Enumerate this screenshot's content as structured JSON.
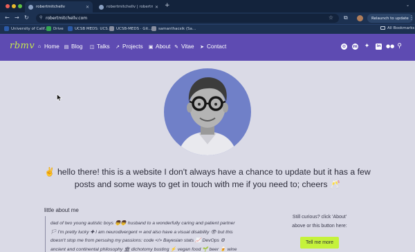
{
  "browser": {
    "tabs": [
      {
        "label": "robertmitchellv",
        "active": true
      },
      {
        "label": "robertmitchellv | robertmitchellv",
        "active": false
      }
    ],
    "new_tab_icon": "plus-icon",
    "url": "robertmitchellv.com",
    "relaunch_label": "Relaunch to update",
    "bookmarks": [
      {
        "label": "University of Calif...",
        "color": "#2b5aa8"
      },
      {
        "label": "Drive",
        "color": "#34a853"
      },
      {
        "label": "UCSB MEDS: UCS...",
        "color": "#2b5aa8"
      },
      {
        "label": "UCSB-MEDS · Git...",
        "color": "#8a8fa0"
      },
      {
        "label": "samanthacsik (Sa...",
        "color": "#8a8fa0"
      }
    ],
    "all_bookmarks": "All Bookmarks"
  },
  "site": {
    "logo": "rbmv",
    "nav": [
      {
        "label": "Home",
        "icon": "home-icon",
        "glyph": "⌂"
      },
      {
        "label": "Blog",
        "icon": "blog-icon",
        "glyph": "▤"
      },
      {
        "label": "Talks",
        "icon": "talks-icon",
        "glyph": "◫"
      },
      {
        "label": "Projects",
        "icon": "projects-icon",
        "glyph": "↗"
      },
      {
        "label": "About",
        "icon": "about-icon",
        "glyph": "▣"
      },
      {
        "label": "Vitae",
        "icon": "vitae-icon",
        "glyph": "✎"
      },
      {
        "label": "Contact",
        "icon": "contact-icon",
        "glyph": "➤"
      }
    ],
    "social_icons": [
      "github-icon",
      "mastodon-icon",
      "twitter-icon",
      "linkedin-icon",
      "flickr-icon",
      "search-icon"
    ],
    "colors": {
      "header": "#5e4bb2",
      "logo": "#c5e84f",
      "page_bg": "#dadae6",
      "button": "#c5f23b",
      "portrait_bg": "#7080c8"
    }
  },
  "main": {
    "greeting": "✌ hello there! this is a website I don't always have a chance to update but it has a few posts and some ways to get in touch with me if you need to; cheers 🥂",
    "about_title": "little about me",
    "about_lines": [
      "dad of two young autistic boys 👦👦 husband to a wonderfully caring and patient partner",
      "🏳 I'm pretty lucky ✚ I am neurodivergent ∞ and also have a visual disability 👁 but this",
      "doesn't stop me from persuing my passions: code </> Bayesian stats 📈 DevOps ⚙",
      "ancient and continental philosophy 🏛 dichotomy busting ⚡ vegan food 🌱 beer 🍺 wine"
    ],
    "curious_line1": "Still curious? click 'About'",
    "curious_line2": "above or this button here:",
    "button_label": "Tell me more"
  }
}
